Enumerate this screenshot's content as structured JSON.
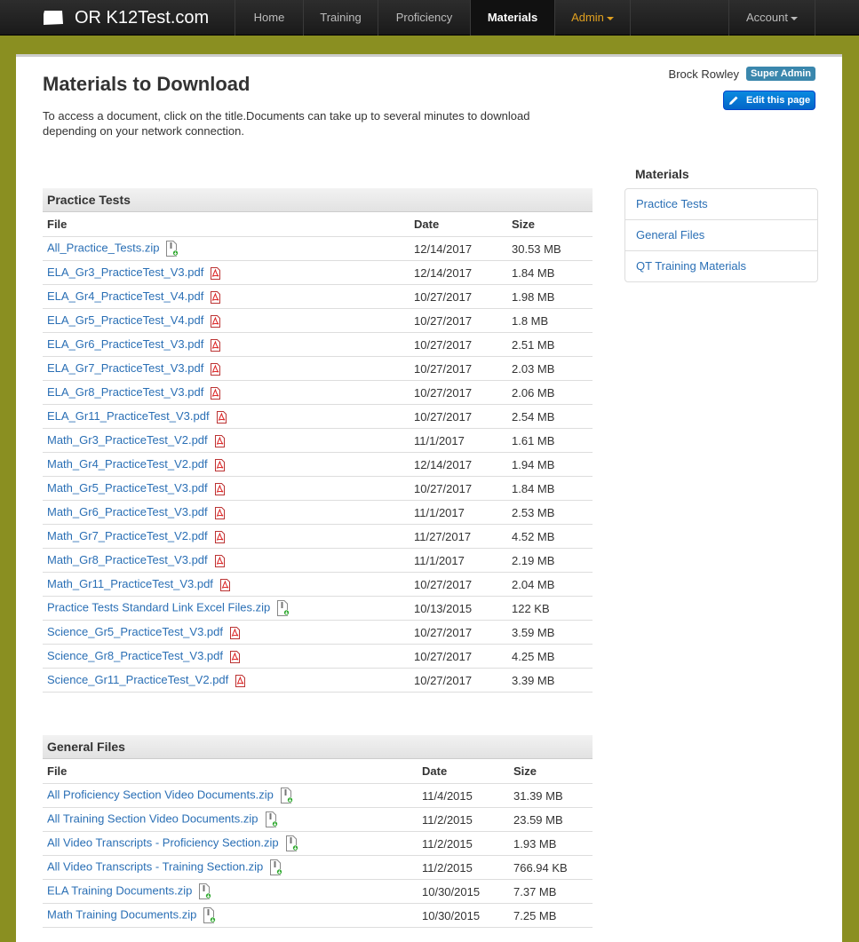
{
  "navbar": {
    "brand": "OR K12Test.com",
    "items": [
      {
        "label": "Home"
      },
      {
        "label": "Training"
      },
      {
        "label": "Proficiency"
      },
      {
        "label": "Materials"
      },
      {
        "label": "Admin"
      },
      {
        "label": "Account"
      }
    ]
  },
  "page": {
    "title": "Materials to Download",
    "intro": "To access a document, click on the title.Documents can take up to several minutes to download depending on your network connection.",
    "user_name": "Brock Rowley",
    "role_badge": "Super Admin",
    "edit_label": "Edit this page"
  },
  "sidebar": {
    "title": "Materials",
    "items": [
      {
        "label": "Practice Tests"
      },
      {
        "label": "General Files"
      },
      {
        "label": "QT Training Materials"
      }
    ]
  },
  "practice": {
    "title": "Practice Tests",
    "headers": {
      "file": "File",
      "date": "Date",
      "size": "Size"
    },
    "rows": [
      {
        "file": "All_Practice_Tests.zip",
        "date": "12/14/2017",
        "size": "30.53 MB",
        "icon": "zip"
      },
      {
        "file": "ELA_Gr3_PracticeTest_V3.pdf",
        "date": "12/14/2017",
        "size": "1.84 MB",
        "icon": "pdf"
      },
      {
        "file": "ELA_Gr4_PracticeTest_V4.pdf",
        "date": "10/27/2017",
        "size": "1.98 MB",
        "icon": "pdf"
      },
      {
        "file": "ELA_Gr5_PracticeTest_V4.pdf",
        "date": "10/27/2017",
        "size": "1.8 MB",
        "icon": "pdf"
      },
      {
        "file": "ELA_Gr6_PracticeTest_V3.pdf",
        "date": "10/27/2017",
        "size": "2.51 MB",
        "icon": "pdf"
      },
      {
        "file": "ELA_Gr7_PracticeTest_V3.pdf",
        "date": "10/27/2017",
        "size": "2.03 MB",
        "icon": "pdf"
      },
      {
        "file": "ELA_Gr8_PracticeTest_V3.pdf",
        "date": "10/27/2017",
        "size": "2.06 MB",
        "icon": "pdf"
      },
      {
        "file": "ELA_Gr11_PracticeTest_V3.pdf",
        "date": "10/27/2017",
        "size": "2.54 MB",
        "icon": "pdf"
      },
      {
        "file": "Math_Gr3_PracticeTest_V2.pdf",
        "date": "11/1/2017",
        "size": "1.61 MB",
        "icon": "pdf"
      },
      {
        "file": "Math_Gr4_PracticeTest_V2.pdf",
        "date": "12/14/2017",
        "size": "1.94 MB",
        "icon": "pdf"
      },
      {
        "file": "Math_Gr5_PracticeTest_V3.pdf",
        "date": "10/27/2017",
        "size": "1.84 MB",
        "icon": "pdf"
      },
      {
        "file": "Math_Gr6_PracticeTest_V3.pdf",
        "date": "11/1/2017",
        "size": "2.53 MB",
        "icon": "pdf"
      },
      {
        "file": "Math_Gr7_PracticeTest_V2.pdf",
        "date": "11/27/2017",
        "size": "4.52 MB",
        "icon": "pdf"
      },
      {
        "file": "Math_Gr8_PracticeTest_V3.pdf",
        "date": "11/1/2017",
        "size": "2.19 MB",
        "icon": "pdf"
      },
      {
        "file": "Math_Gr11_PracticeTest_V3.pdf",
        "date": "10/27/2017",
        "size": "2.04 MB",
        "icon": "pdf"
      },
      {
        "file": "Practice Tests Standard Link Excel Files.zip",
        "date": "10/13/2015",
        "size": "122 KB",
        "icon": "zip"
      },
      {
        "file": "Science_Gr5_PracticeTest_V3.pdf",
        "date": "10/27/2017",
        "size": "3.59 MB",
        "icon": "pdf"
      },
      {
        "file": "Science_Gr8_PracticeTest_V3.pdf",
        "date": "10/27/2017",
        "size": "4.25 MB",
        "icon": "pdf"
      },
      {
        "file": "Science_Gr11_PracticeTest_V2.pdf",
        "date": "10/27/2017",
        "size": "3.39 MB",
        "icon": "pdf"
      }
    ]
  },
  "general": {
    "title": "General Files",
    "headers": {
      "file": "File",
      "date": "Date",
      "size": "Size"
    },
    "rows": [
      {
        "file": "All Proficiency Section Video Documents.zip",
        "date": "11/4/2015",
        "size": "31.39 MB",
        "icon": "zip"
      },
      {
        "file": "All Training Section Video Documents.zip",
        "date": "11/2/2015",
        "size": "23.59 MB",
        "icon": "zip"
      },
      {
        "file": "All Video Transcripts - Proficiency Section.zip",
        "date": "11/2/2015",
        "size": "1.93 MB",
        "icon": "zip"
      },
      {
        "file": "All Video Transcripts - Training Section.zip",
        "date": "11/2/2015",
        "size": "766.94 KB",
        "icon": "zip"
      },
      {
        "file": "ELA Training Documents.zip",
        "date": "10/30/2015",
        "size": "7.37 MB",
        "icon": "zip"
      },
      {
        "file": "Math Training Documents.zip",
        "date": "10/30/2015",
        "size": "7.25 MB",
        "icon": "zip"
      }
    ]
  },
  "colors": {
    "background": "#8a8f21",
    "link": "#2a6fb5",
    "badge": "#3a87ad",
    "edit_button": "#0a79d8"
  }
}
